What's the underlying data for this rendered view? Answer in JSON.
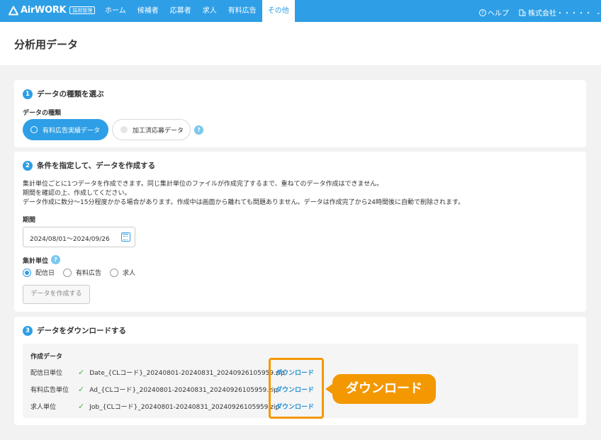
{
  "header": {
    "logo_text": "AirWORK",
    "logo_badge": "採用管理",
    "nav": [
      "ホーム",
      "候補者",
      "応募者",
      "求人",
      "有料広告",
      "その他"
    ],
    "active_nav": "その他",
    "help_label": "ヘルプ",
    "company_label": "株式会社・・・・・"
  },
  "page_title": "分析用データ",
  "section1": {
    "number": "1",
    "title": "データの種類を選ぶ",
    "field_label": "データの種類",
    "options": [
      "有料広告実績データ",
      "加工済応募データ"
    ],
    "selected": "有料広告実績データ",
    "help": "?"
  },
  "section2": {
    "number": "2",
    "title": "条件を指定して、データを作成する",
    "desc": [
      "集計単位ごとに1つデータを作成できます。同じ集計単位のファイルが作成完了するまで、重ねてのデータ作成はできません。",
      "期間を確認の上、作成してください。",
      "データ作成に数分〜15分程度かかる場合があります。作成中は画面から離れても問題ありません。データは作成完了から24時間後に自動で削除されます。"
    ],
    "period_label": "期間",
    "period_value": "2024/08/01〜2024/09/26",
    "unit_label": "集計単位",
    "unit_help": "?",
    "units": [
      "配信日",
      "有料広告",
      "求人"
    ],
    "selected_unit": "配信日",
    "create_button": "データを作成する"
  },
  "section3": {
    "number": "3",
    "title": "データをダウンロードする",
    "box_title": "作成データ",
    "rows": [
      {
        "label": "配信日単位",
        "file": "Date_{CLコード}_20240801-20240831_20240926105959.zip",
        "link": "ダウンロード"
      },
      {
        "label": "有料広告単位",
        "file": "Ad_{CLコード}_20240801-20240831_20240926105959.zip",
        "link": "ダウンロード"
      },
      {
        "label": "求人単位",
        "file": "Job_{CLコード}_20240801-20240831_20240926105959.zip",
        "link": "ダウンロード"
      }
    ]
  },
  "callout": "ダウンロード",
  "colors": {
    "brand": "#2e9fe6",
    "accent": "#f39800",
    "success": "#4caf50"
  }
}
